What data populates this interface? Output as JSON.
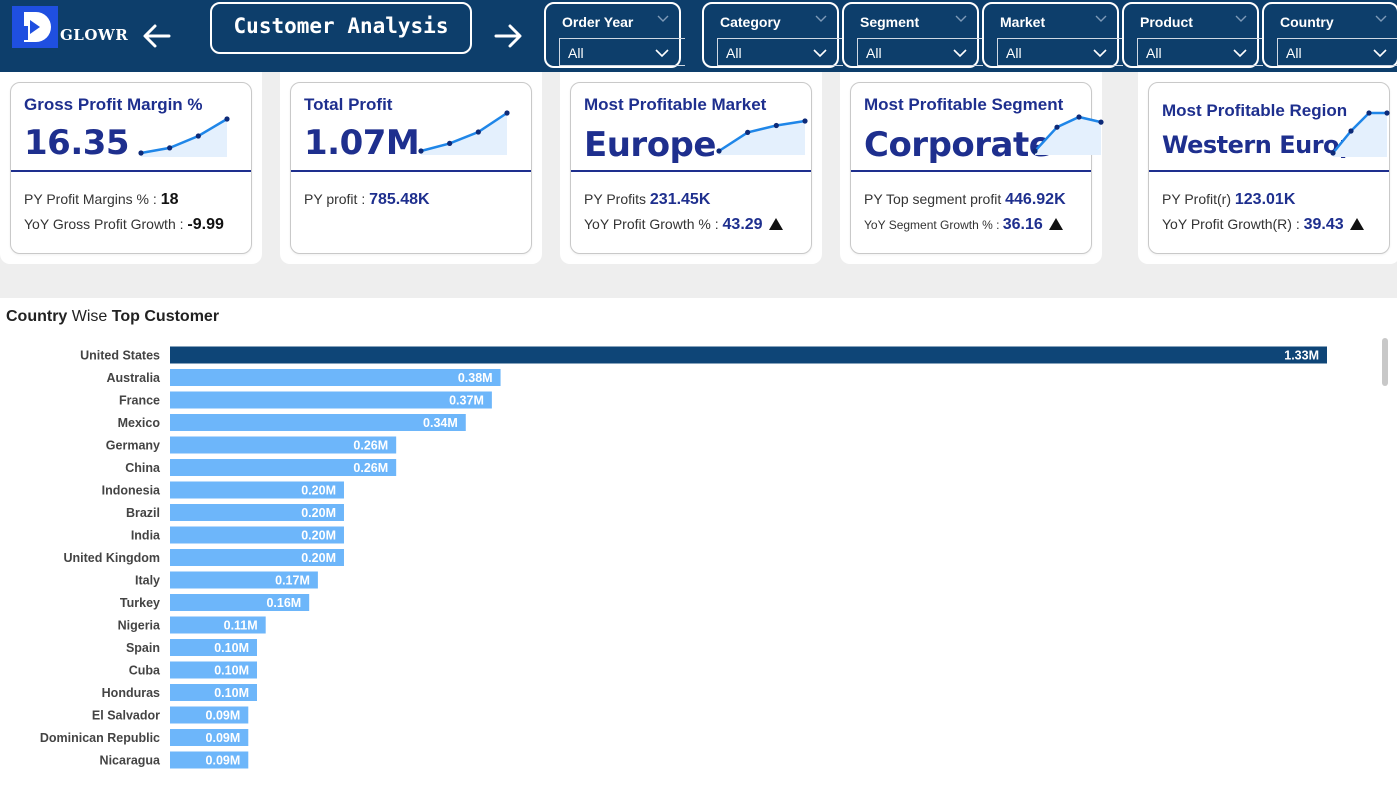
{
  "brand": {
    "name": "GLOWR"
  },
  "header": {
    "title": "Customer Analysis",
    "back_icon": "arrow-left-icon",
    "forward_icon": "arrow-right-icon"
  },
  "slicers": [
    {
      "label": "Order Year",
      "value": "All"
    },
    {
      "label": "Category",
      "value": "All"
    },
    {
      "label": "Segment",
      "value": "All"
    },
    {
      "label": "Market",
      "value": "All"
    },
    {
      "label": "Product",
      "value": "All"
    },
    {
      "label": "Country",
      "value": "All"
    }
  ],
  "kpis": [
    {
      "title": "Gross Profit Margin %",
      "value": "16.35",
      "line1_label": "PY Profit Margins % : ",
      "line1_value": "18",
      "line2_label": "YoY Gross Profit Growth : ",
      "line2_value": "-9.99",
      "trend": [
        0.0,
        0.15,
        0.5,
        1.0
      ]
    },
    {
      "title": "Total Profit",
      "value": "1.07M",
      "line1_label": "PY profit : ",
      "line1_value": "785.48K",
      "trend": [
        0.0,
        0.2,
        0.5,
        1.0
      ]
    },
    {
      "title": "Most Profitable Market",
      "value": "Europe",
      "line1_label": "PY Profits ",
      "line1_value": "231.45K",
      "line2_label": "YoY Profit Growth % : ",
      "line2_value": "43.29",
      "trend": [
        0.0,
        0.62,
        0.85,
        1.0
      ]
    },
    {
      "title": "Most Profitable Segment",
      "value": "Corporate",
      "line1_label": "PY Top segment profit ",
      "line1_value": "446.92K",
      "line2_label": "YoY Segment Growth % : ",
      "line2_value": "36.16",
      "trend": [
        0.0,
        0.7,
        1.0,
        0.85
      ]
    },
    {
      "title": "Most Profitable Region",
      "value": "Western Europe",
      "line1_label": "PY Profit(r) ",
      "line1_value": "123.01K",
      "line2_label": "YoY Profit Growth(R) : ",
      "line2_value": "39.43",
      "trend": [
        0.0,
        0.55,
        1.0,
        1.0
      ]
    }
  ],
  "chart_title": {
    "part1": "Country",
    "part2": " Wise ",
    "part3": "Top Customer"
  },
  "colors": {
    "header": "#0d3e6b",
    "highlight_bar": "#0e4577",
    "bar": "#6db6fa",
    "kpi_text": "#1e2f8e",
    "spark_line": "#1f86e8"
  },
  "chart_data": {
    "type": "bar",
    "orientation": "horizontal",
    "title": "Country Wise Top Customer",
    "categories": [
      "United States",
      "Australia",
      "France",
      "Mexico",
      "Germany",
      "China",
      "Indonesia",
      "Brazil",
      "India",
      "United Kingdom",
      "Italy",
      "Turkey",
      "Nigeria",
      "Spain",
      "Cuba",
      "Honduras",
      "El Salvador",
      "Dominican Republic",
      "Nicaragua"
    ],
    "values": [
      1.33,
      0.38,
      0.37,
      0.34,
      0.26,
      0.26,
      0.2,
      0.2,
      0.2,
      0.2,
      0.17,
      0.16,
      0.11,
      0.1,
      0.1,
      0.1,
      0.09,
      0.09,
      0.09
    ],
    "data_labels": [
      "1.33M",
      "0.38M",
      "0.37M",
      "0.34M",
      "0.26M",
      "0.26M",
      "0.20M",
      "0.20M",
      "0.20M",
      "0.20M",
      "0.17M",
      "0.16M",
      "0.11M",
      "0.10M",
      "0.10M",
      "0.10M",
      "0.09M",
      "0.09M",
      "0.09M"
    ],
    "unit": "M",
    "highlight": "United States"
  }
}
